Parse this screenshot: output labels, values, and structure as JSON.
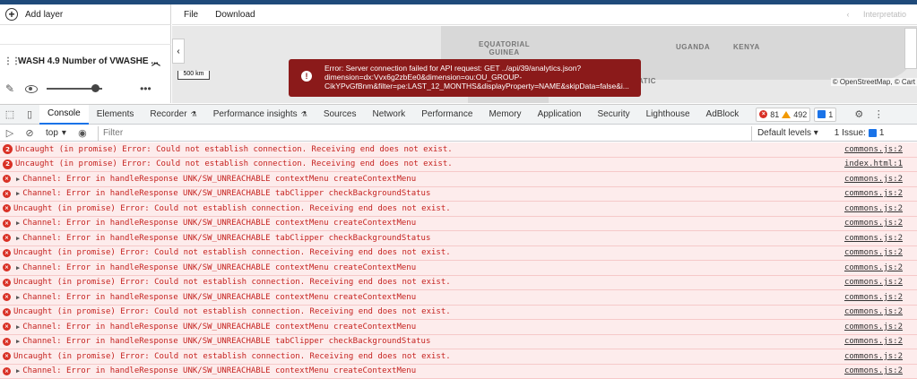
{
  "app": {
    "add_layer_label": "Add layer",
    "menu": [
      "File",
      "Download"
    ],
    "interpretation_label": "Interpretatio",
    "layer_title": "WASH 4.9 Number of VWASHE ...",
    "map_labels": {
      "equatorial_guinea": "EQUATORIAL\nGUINEA",
      "uganda": "UGANDA",
      "kenya": "KENYA",
      "atic": "ATIC"
    },
    "scale_label": "500 km",
    "attribution": "© OpenStreetMap, © Cart",
    "error_message": "Error: Server connection failed for API request: GET ../api/39/analytics.json?dimension=dx:Vvx6g2zbEe0&dimension=ou:OU_GROUP-CikYPvGfBnm&filter=pe:LAST_12_MONTHS&displayProperty=NAME&skipData=false&i..."
  },
  "devtools": {
    "tabs": [
      "Console",
      "Elements",
      "Recorder",
      "Performance insights",
      "Sources",
      "Network",
      "Performance",
      "Memory",
      "Application",
      "Security",
      "Lighthouse",
      "AdBlock"
    ],
    "active_tab": "Console",
    "error_count": "81",
    "warning_count": "492",
    "info_count": "1",
    "context": "top",
    "filter_placeholder": "Filter",
    "levels": "Default levels",
    "issues_label": "1 Issue:",
    "issues_count": "1",
    "rows": [
      {
        "kind": "badge",
        "badge": "2",
        "expand": false,
        "text": "Uncaught (in promise) Error: Could not establish connection. Receiving end does not exist.",
        "src": "commons.js:2"
      },
      {
        "kind": "badge",
        "badge": "2",
        "expand": false,
        "text": "Uncaught (in promise) Error: Could not establish connection. Receiving end does not exist.",
        "src": "index.html:1"
      },
      {
        "kind": "x",
        "badge": "",
        "expand": true,
        "text": "Channel: Error in handleResponse UNK/SW_UNREACHABLE contextMenu createContextMenu",
        "src": "commons.js:2"
      },
      {
        "kind": "x",
        "badge": "",
        "expand": true,
        "text": "Channel: Error in handleResponse UNK/SW_UNREACHABLE tabClipper checkBackgroundStatus",
        "src": "commons.js:2"
      },
      {
        "kind": "x",
        "badge": "",
        "expand": false,
        "text": "Uncaught (in promise) Error: Could not establish connection. Receiving end does not exist.",
        "src": "commons.js:2"
      },
      {
        "kind": "x",
        "badge": "",
        "expand": true,
        "text": "Channel: Error in handleResponse UNK/SW_UNREACHABLE contextMenu createContextMenu",
        "src": "commons.js:2"
      },
      {
        "kind": "x",
        "badge": "",
        "expand": true,
        "text": "Channel: Error in handleResponse UNK/SW_UNREACHABLE tabClipper checkBackgroundStatus",
        "src": "commons.js:2"
      },
      {
        "kind": "x",
        "badge": "",
        "expand": false,
        "text": "Uncaught (in promise) Error: Could not establish connection. Receiving end does not exist.",
        "src": "commons.js:2"
      },
      {
        "kind": "x",
        "badge": "",
        "expand": true,
        "text": "Channel: Error in handleResponse UNK/SW_UNREACHABLE contextMenu createContextMenu",
        "src": "commons.js:2"
      },
      {
        "kind": "x",
        "badge": "",
        "expand": false,
        "text": "Uncaught (in promise) Error: Could not establish connection. Receiving end does not exist.",
        "src": "commons.js:2"
      },
      {
        "kind": "x",
        "badge": "",
        "expand": true,
        "text": "Channel: Error in handleResponse UNK/SW_UNREACHABLE contextMenu createContextMenu",
        "src": "commons.js:2"
      },
      {
        "kind": "x",
        "badge": "",
        "expand": false,
        "text": "Uncaught (in promise) Error: Could not establish connection. Receiving end does not exist.",
        "src": "commons.js:2"
      },
      {
        "kind": "x",
        "badge": "",
        "expand": true,
        "text": "Channel: Error in handleResponse UNK/SW_UNREACHABLE contextMenu createContextMenu",
        "src": "commons.js:2"
      },
      {
        "kind": "x",
        "badge": "",
        "expand": true,
        "text": "Channel: Error in handleResponse UNK/SW_UNREACHABLE tabClipper checkBackgroundStatus",
        "src": "commons.js:2"
      },
      {
        "kind": "x",
        "badge": "",
        "expand": false,
        "text": "Uncaught (in promise) Error: Could not establish connection. Receiving end does not exist.",
        "src": "commons.js:2"
      },
      {
        "kind": "x",
        "badge": "",
        "expand": true,
        "text": "Channel: Error in handleResponse UNK/SW_UNREACHABLE contextMenu createContextMenu",
        "src": "commons.js:2"
      }
    ]
  },
  "colors": {
    "topbar": "#1f4a7a",
    "error_toast": "#8b1a1a",
    "error_row_bg": "#fdecec",
    "error_text": "#c5221f",
    "active_tab_underline": "#1a73e8"
  }
}
